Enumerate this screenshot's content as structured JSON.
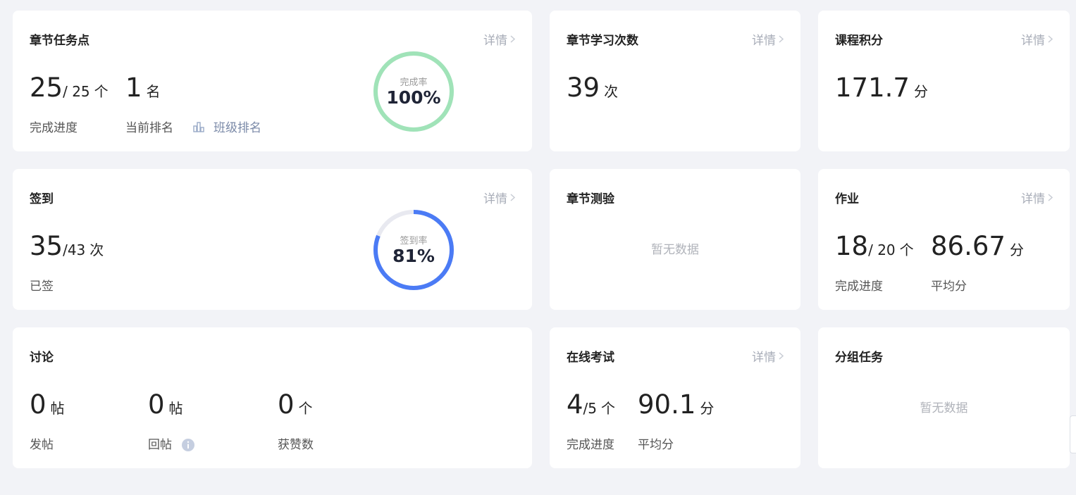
{
  "detail_label": "详情",
  "chapter_tasks": {
    "title": "章节任务点",
    "done": "25",
    "total": "/ 25",
    "unit": "个",
    "progress_label": "完成进度",
    "rank": "1",
    "rank_unit": "名",
    "rank_label": "当前排名",
    "class_rank_label": "班级排名",
    "ring_label": "完成率",
    "ring_value": "100%",
    "rate": 1.0,
    "ring_color": "#a0e3b8"
  },
  "chapter_study": {
    "title": "章节学习次数",
    "count": "39",
    "unit": "次"
  },
  "course_points": {
    "title": "课程积分",
    "value": "171.7",
    "unit": "分"
  },
  "signin": {
    "title": "签到",
    "done": "35",
    "total": "/43",
    "unit": "次",
    "label": "已签",
    "ring_label": "签到率",
    "ring_value": "81%",
    "rate": 0.81,
    "ring_color": "#4b7bf5",
    "track_color": "#e8e9f0"
  },
  "chapter_quiz": {
    "title": "章节测验",
    "empty": "暂无数据"
  },
  "homework": {
    "title": "作业",
    "done": "18",
    "total": "/ 20",
    "unit": "个",
    "progress_label": "完成进度",
    "avg": "86.67",
    "avg_unit": "分",
    "avg_label": "平均分"
  },
  "discussion": {
    "title": "讨论",
    "posts": "0",
    "posts_unit": "帖",
    "posts_label": "发帖",
    "replies": "0",
    "replies_unit": "帖",
    "replies_label": "回帖",
    "likes": "0",
    "likes_unit": "个",
    "likes_label": "获赞数"
  },
  "online_exam": {
    "title": "在线考试",
    "done": "4",
    "total": "/5",
    "unit": "个",
    "progress_label": "完成进度",
    "avg": "90.1",
    "avg_unit": "分",
    "avg_label": "平均分"
  },
  "group_tasks": {
    "title": "分组任务",
    "empty": "暂无数据"
  }
}
